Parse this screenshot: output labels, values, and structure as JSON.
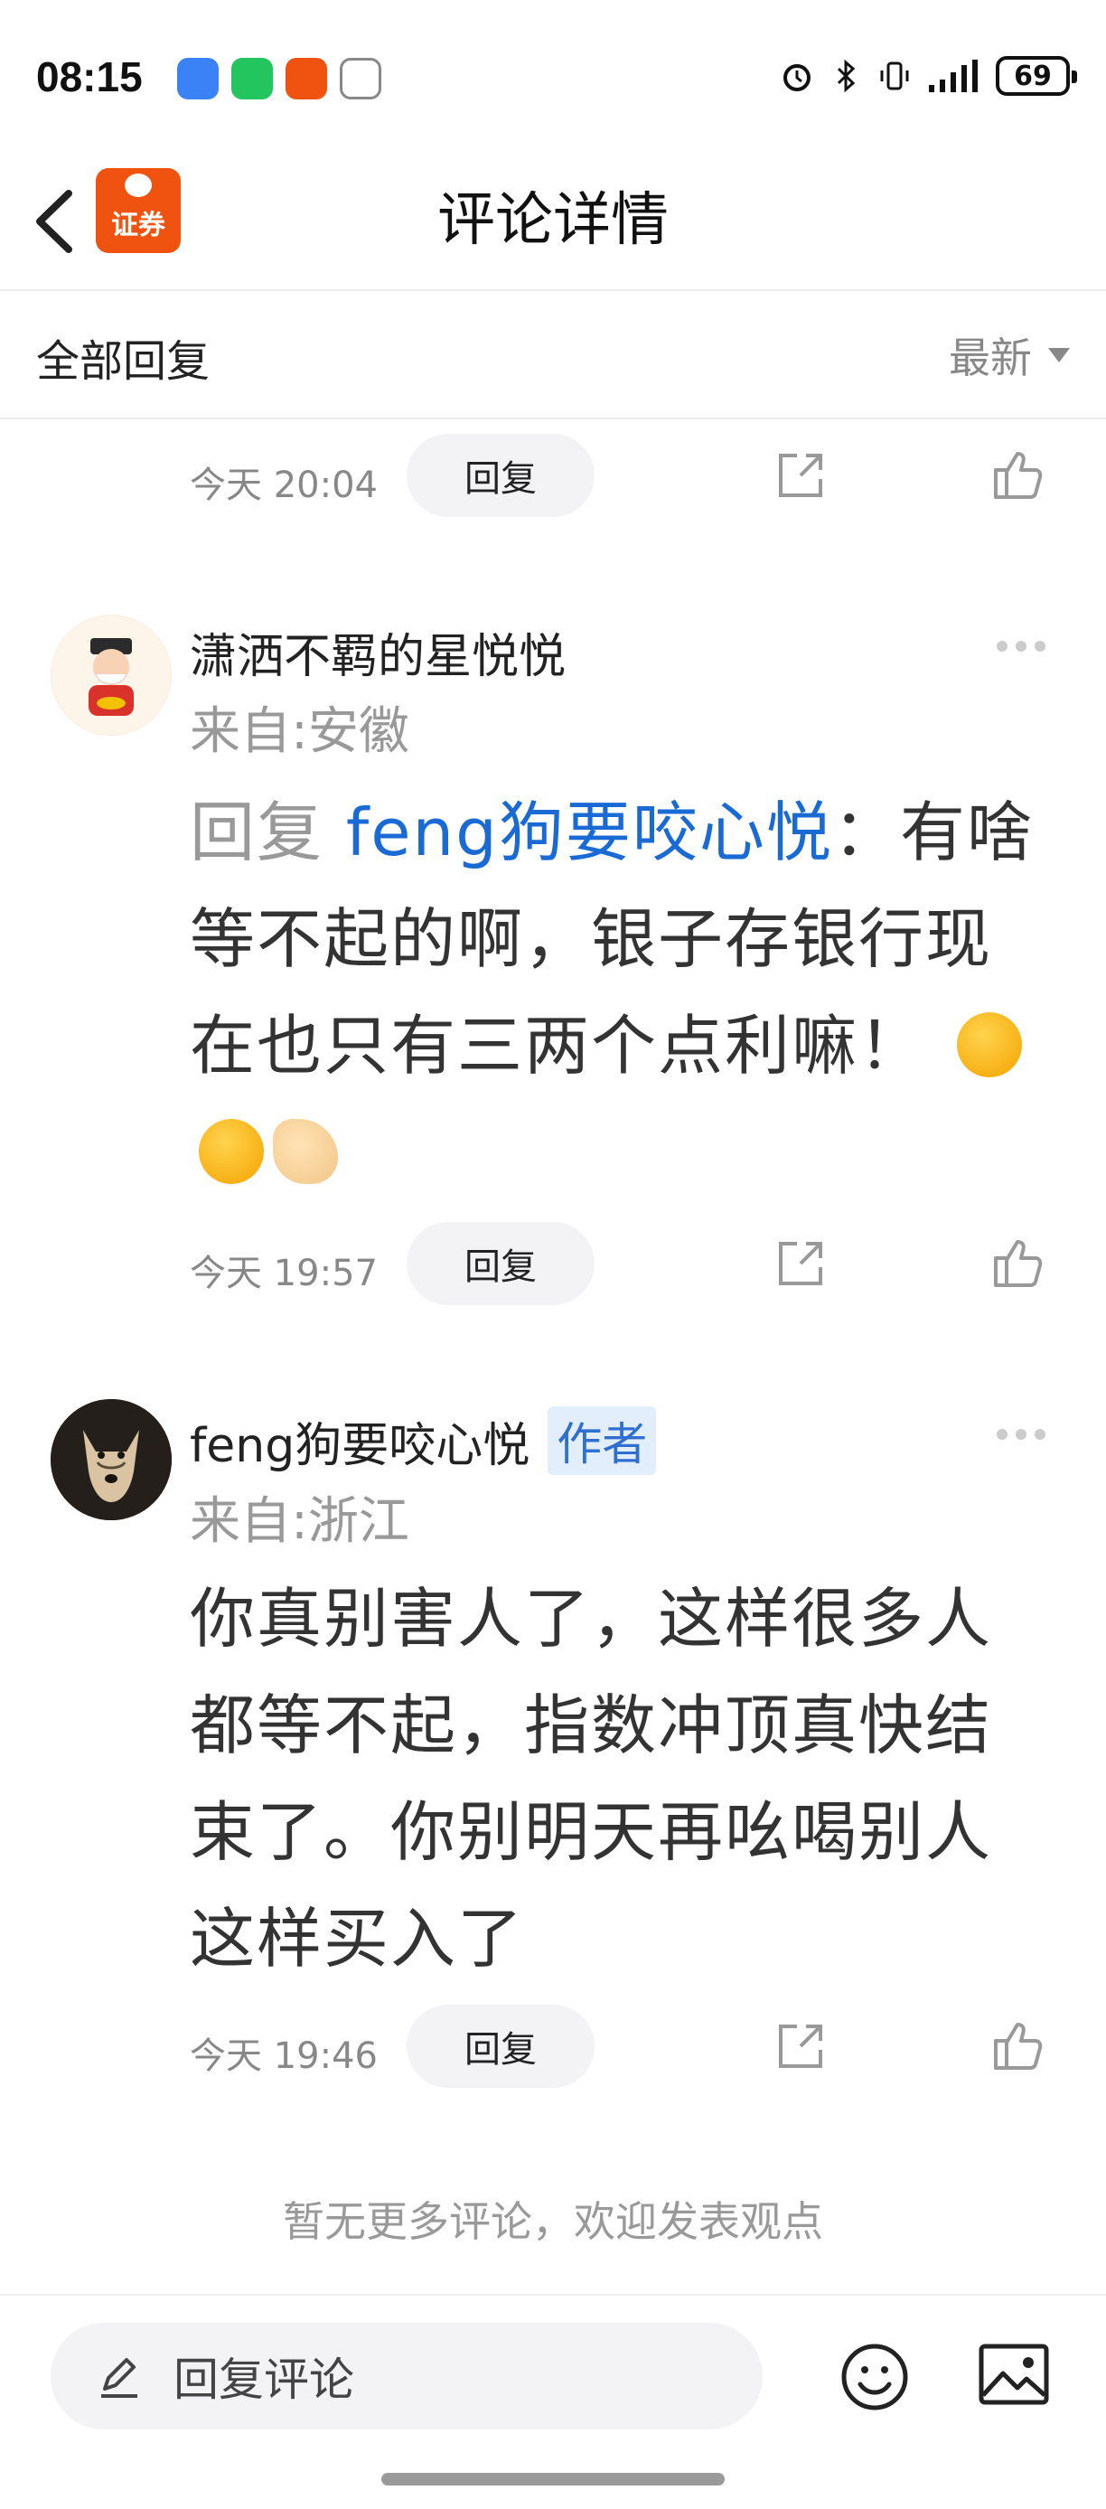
{
  "status_bar": {
    "time": "08:15",
    "battery": "69"
  },
  "nav": {
    "title": "评论详情",
    "logo_text": "证券"
  },
  "filter": {
    "label": "全部回复",
    "sort": "最新"
  },
  "top_action": {
    "time": "今天 20:04",
    "reply_label": "回复"
  },
  "comments": [
    {
      "author": "潇洒不羁的星悦悦",
      "location": "来自:安徽",
      "reply_prefix": "回复 ",
      "mention": "feng狗要咬心悦",
      "text": "：有啥等不起的啊，银子存银行现在也只有三两个点利嘛！",
      "emojis": [
        "wink-tongue-emoji",
        "wink-tongue-emoji",
        "ok-hand-emoji"
      ],
      "time": "今天 19:57",
      "reply_label": "回复"
    },
    {
      "author": "feng狗要咬心悦",
      "badge": "作者",
      "location": "来自:浙江",
      "text": "你真别害人了，这样很多人都等不起，指数冲顶真快结束了。你别明天再吆喝别人这样买入了",
      "time": "今天 19:46",
      "reply_label": "回复"
    }
  ],
  "footer": {
    "no_more": "暂无更多评论，欢迎发表观点"
  },
  "bottom_bar": {
    "input_placeholder": "回复评论"
  },
  "colors": {
    "accent_blue": "#1a6ad6",
    "logo_orange": "#f0520f",
    "muted_gray": "#999999"
  }
}
